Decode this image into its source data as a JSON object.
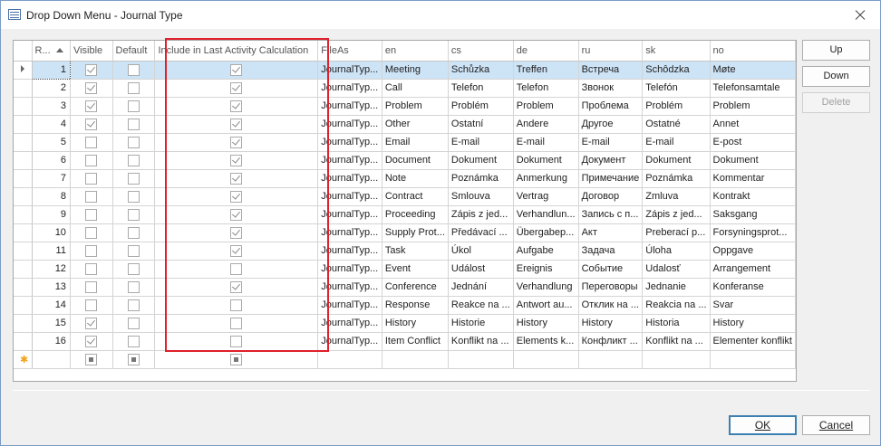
{
  "window": {
    "title": "Drop Down Menu - Journal Type"
  },
  "grid": {
    "headers": {
      "rank": "R...",
      "visible": "Visible",
      "default": "Default",
      "include": "Include in Last Activity Calculation",
      "fileas": "FileAs",
      "en": "en",
      "cs": "cs",
      "de": "de",
      "ru": "ru",
      "sk": "sk",
      "no": "no"
    },
    "rows": [
      {
        "rank": "1",
        "visible": true,
        "default": false,
        "include": true,
        "fileas": "JournalTyp...",
        "en": "Meeting",
        "cs": "Schůzka",
        "de": "Treffen",
        "ru": "Встреча",
        "sk": "Schôdzka",
        "no": "Møte"
      },
      {
        "rank": "2",
        "visible": true,
        "default": false,
        "include": true,
        "fileas": "JournalTyp...",
        "en": "Call",
        "cs": "Telefon",
        "de": "Telefon",
        "ru": "Звонок",
        "sk": "Telefón",
        "no": "Telefonsamtale"
      },
      {
        "rank": "3",
        "visible": true,
        "default": false,
        "include": true,
        "fileas": "JournalTyp...",
        "en": "Problem",
        "cs": "Problém",
        "de": "Problem",
        "ru": "Проблема",
        "sk": "Problém",
        "no": "Problem"
      },
      {
        "rank": "4",
        "visible": true,
        "default": false,
        "include": true,
        "fileas": "JournalTyp...",
        "en": "Other",
        "cs": "Ostatní",
        "de": "Andere",
        "ru": "Другое",
        "sk": "Ostatné",
        "no": "Annet"
      },
      {
        "rank": "5",
        "visible": false,
        "default": false,
        "include": true,
        "fileas": "JournalTyp...",
        "en": "Email",
        "cs": "E-mail",
        "de": "E-mail",
        "ru": "E-mail",
        "sk": "E-mail",
        "no": "E-post"
      },
      {
        "rank": "6",
        "visible": false,
        "default": false,
        "include": true,
        "fileas": "JournalTyp...",
        "en": "Document",
        "cs": "Dokument",
        "de": "Dokument",
        "ru": "Документ",
        "sk": "Dokument",
        "no": "Dokument"
      },
      {
        "rank": "7",
        "visible": false,
        "default": false,
        "include": true,
        "fileas": "JournalTyp...",
        "en": "Note",
        "cs": "Poznámka",
        "de": "Anmerkung",
        "ru": "Примечание",
        "sk": "Poznámka",
        "no": "Kommentar"
      },
      {
        "rank": "8",
        "visible": false,
        "default": false,
        "include": true,
        "fileas": "JournalTyp...",
        "en": "Contract",
        "cs": "Smlouva",
        "de": "Vertrag",
        "ru": "Договор",
        "sk": "Zmluva",
        "no": "Kontrakt"
      },
      {
        "rank": "9",
        "visible": false,
        "default": false,
        "include": true,
        "fileas": "JournalTyp...",
        "en": "Proceeding",
        "cs": "Zápis z jed...",
        "de": "Verhandlun...",
        "ru": "Запись с п...",
        "sk": "Zápis z jed...",
        "no": "Saksgang"
      },
      {
        "rank": "10",
        "visible": false,
        "default": false,
        "include": true,
        "fileas": "JournalTyp...",
        "en": "Supply Prot...",
        "cs": "Předávací ...",
        "de": "Übergabep...",
        "ru": "Акт",
        "sk": "Preberací p...",
        "no": "Forsyningsprot..."
      },
      {
        "rank": "11",
        "visible": false,
        "default": false,
        "include": true,
        "fileas": "JournalTyp...",
        "en": "Task",
        "cs": "Úkol",
        "de": "Aufgabe",
        "ru": "Задача",
        "sk": "Úloha",
        "no": "Oppgave"
      },
      {
        "rank": "12",
        "visible": false,
        "default": false,
        "include": false,
        "fileas": "JournalTyp...",
        "en": "Event",
        "cs": "Událost",
        "de": "Ereignis",
        "ru": "Событие",
        "sk": "Udalosť",
        "no": "Arrangement"
      },
      {
        "rank": "13",
        "visible": false,
        "default": false,
        "include": true,
        "fileas": "JournalTyp...",
        "en": "Conference",
        "cs": "Jednání",
        "de": "Verhandlung",
        "ru": "Переговоры",
        "sk": "Jednanie",
        "no": "Konferanse"
      },
      {
        "rank": "14",
        "visible": false,
        "default": false,
        "include": false,
        "fileas": "JournalTyp...",
        "en": "Response",
        "cs": "Reakce na ...",
        "de": "Antwort au...",
        "ru": "Отклик на ...",
        "sk": "Reakcia na ...",
        "no": "Svar"
      },
      {
        "rank": "15",
        "visible": true,
        "default": false,
        "include": false,
        "fileas": "JournalTyp...",
        "en": "History",
        "cs": "Historie",
        "de": "History",
        "ru": "History",
        "sk": "Historia",
        "no": "History"
      },
      {
        "rank": "16",
        "visible": true,
        "default": false,
        "include": false,
        "fileas": "JournalTyp...",
        "en": "Item Conflict",
        "cs": "Konflikt na ...",
        "de": "Elements k...",
        "ru": "Конфликт ...",
        "sk": "Konflikt na ...",
        "no": "Elementer konflikt"
      }
    ]
  },
  "side_buttons": {
    "up": "Up",
    "down": "Down",
    "delete": "Delete"
  },
  "footer": {
    "ok": "OK",
    "cancel": "Cancel"
  },
  "colors": {
    "selection": "#cde3f6",
    "highlight_border": "#e0202a",
    "default_button_border": "#3c7fb1"
  }
}
